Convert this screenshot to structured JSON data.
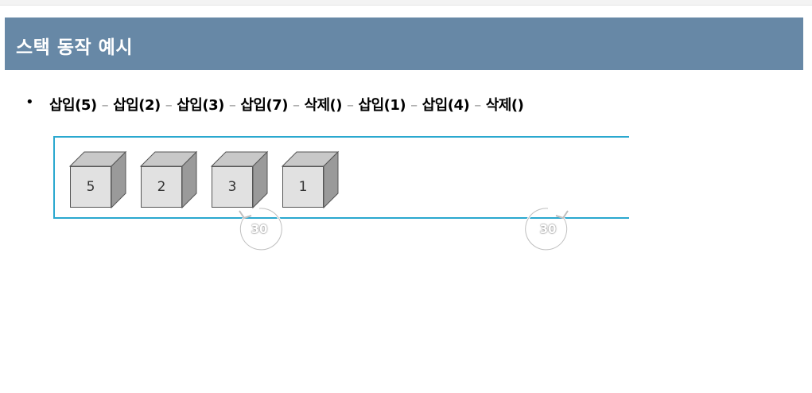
{
  "title": "스택 동작 예시",
  "bullet": "•",
  "operations": [
    "삽입(5)",
    "삽입(2)",
    "삽입(3)",
    "삽입(7)",
    "삭제()",
    "삽입(1)",
    "삽입(4)",
    "삭제()"
  ],
  "separator": "–",
  "stack": {
    "items": [
      "5",
      "2",
      "3",
      "1"
    ]
  },
  "video_controls": {
    "rewind_label": "30",
    "forward_label": "30"
  },
  "colors": {
    "title_bar": "#6788a6",
    "frame_line": "#2aa8cf",
    "cube_front": "#e1e1e1",
    "cube_top": "#c8c8c8",
    "cube_side": "#9a9a9a"
  }
}
